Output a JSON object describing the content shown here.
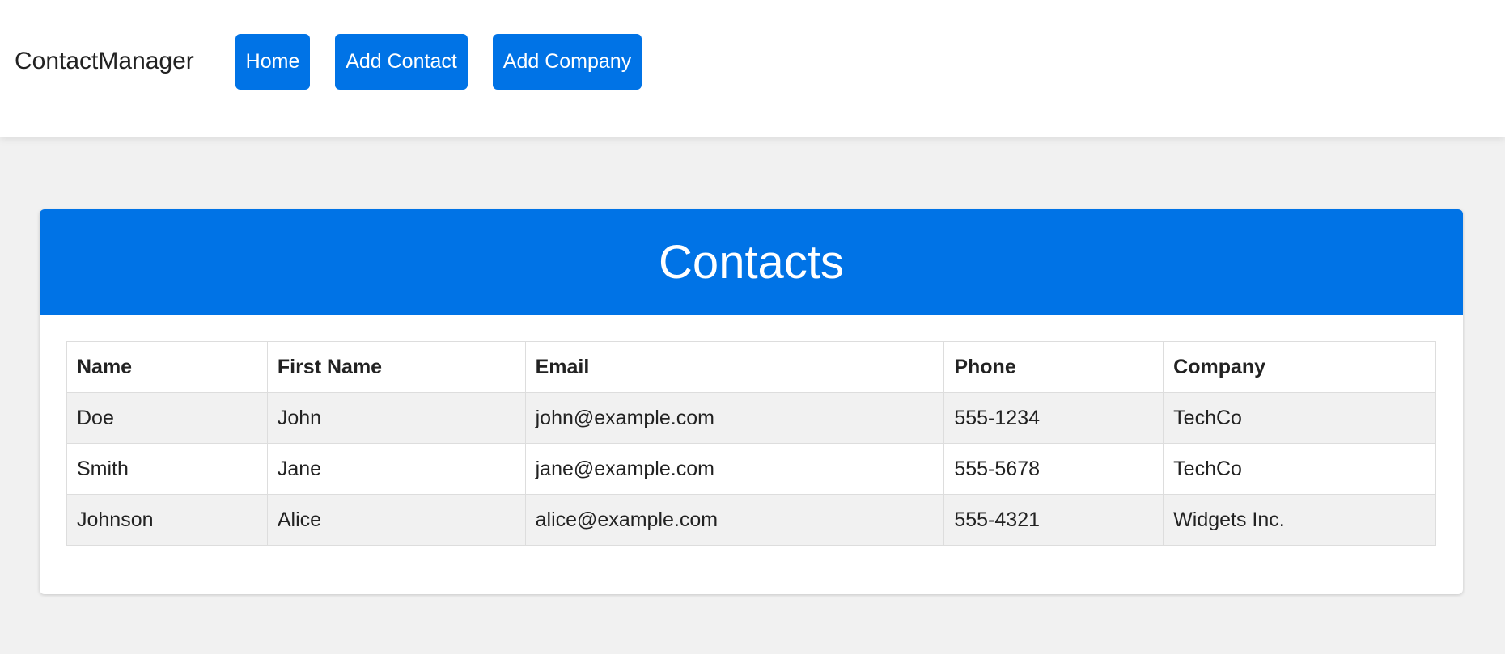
{
  "header": {
    "brand": "ContactManager",
    "nav": [
      {
        "label": "Home"
      },
      {
        "label": "Add Contact"
      },
      {
        "label": "Add Company"
      }
    ]
  },
  "main": {
    "title": "Contacts",
    "table": {
      "columns": [
        "Name",
        "First Name",
        "Email",
        "Phone",
        "Company"
      ],
      "rows": [
        [
          "Doe",
          "John",
          "john@example.com",
          "555-1234",
          "TechCo"
        ],
        [
          "Smith",
          "Jane",
          "jane@example.com",
          "555-5678",
          "TechCo"
        ],
        [
          "Johnson",
          "Alice",
          "alice@example.com",
          "555-4321",
          "Widgets Inc."
        ]
      ]
    }
  },
  "colors": {
    "accent": "#0073e6",
    "page_background": "#f1f1f1",
    "stripe": "#f1f1f1"
  }
}
